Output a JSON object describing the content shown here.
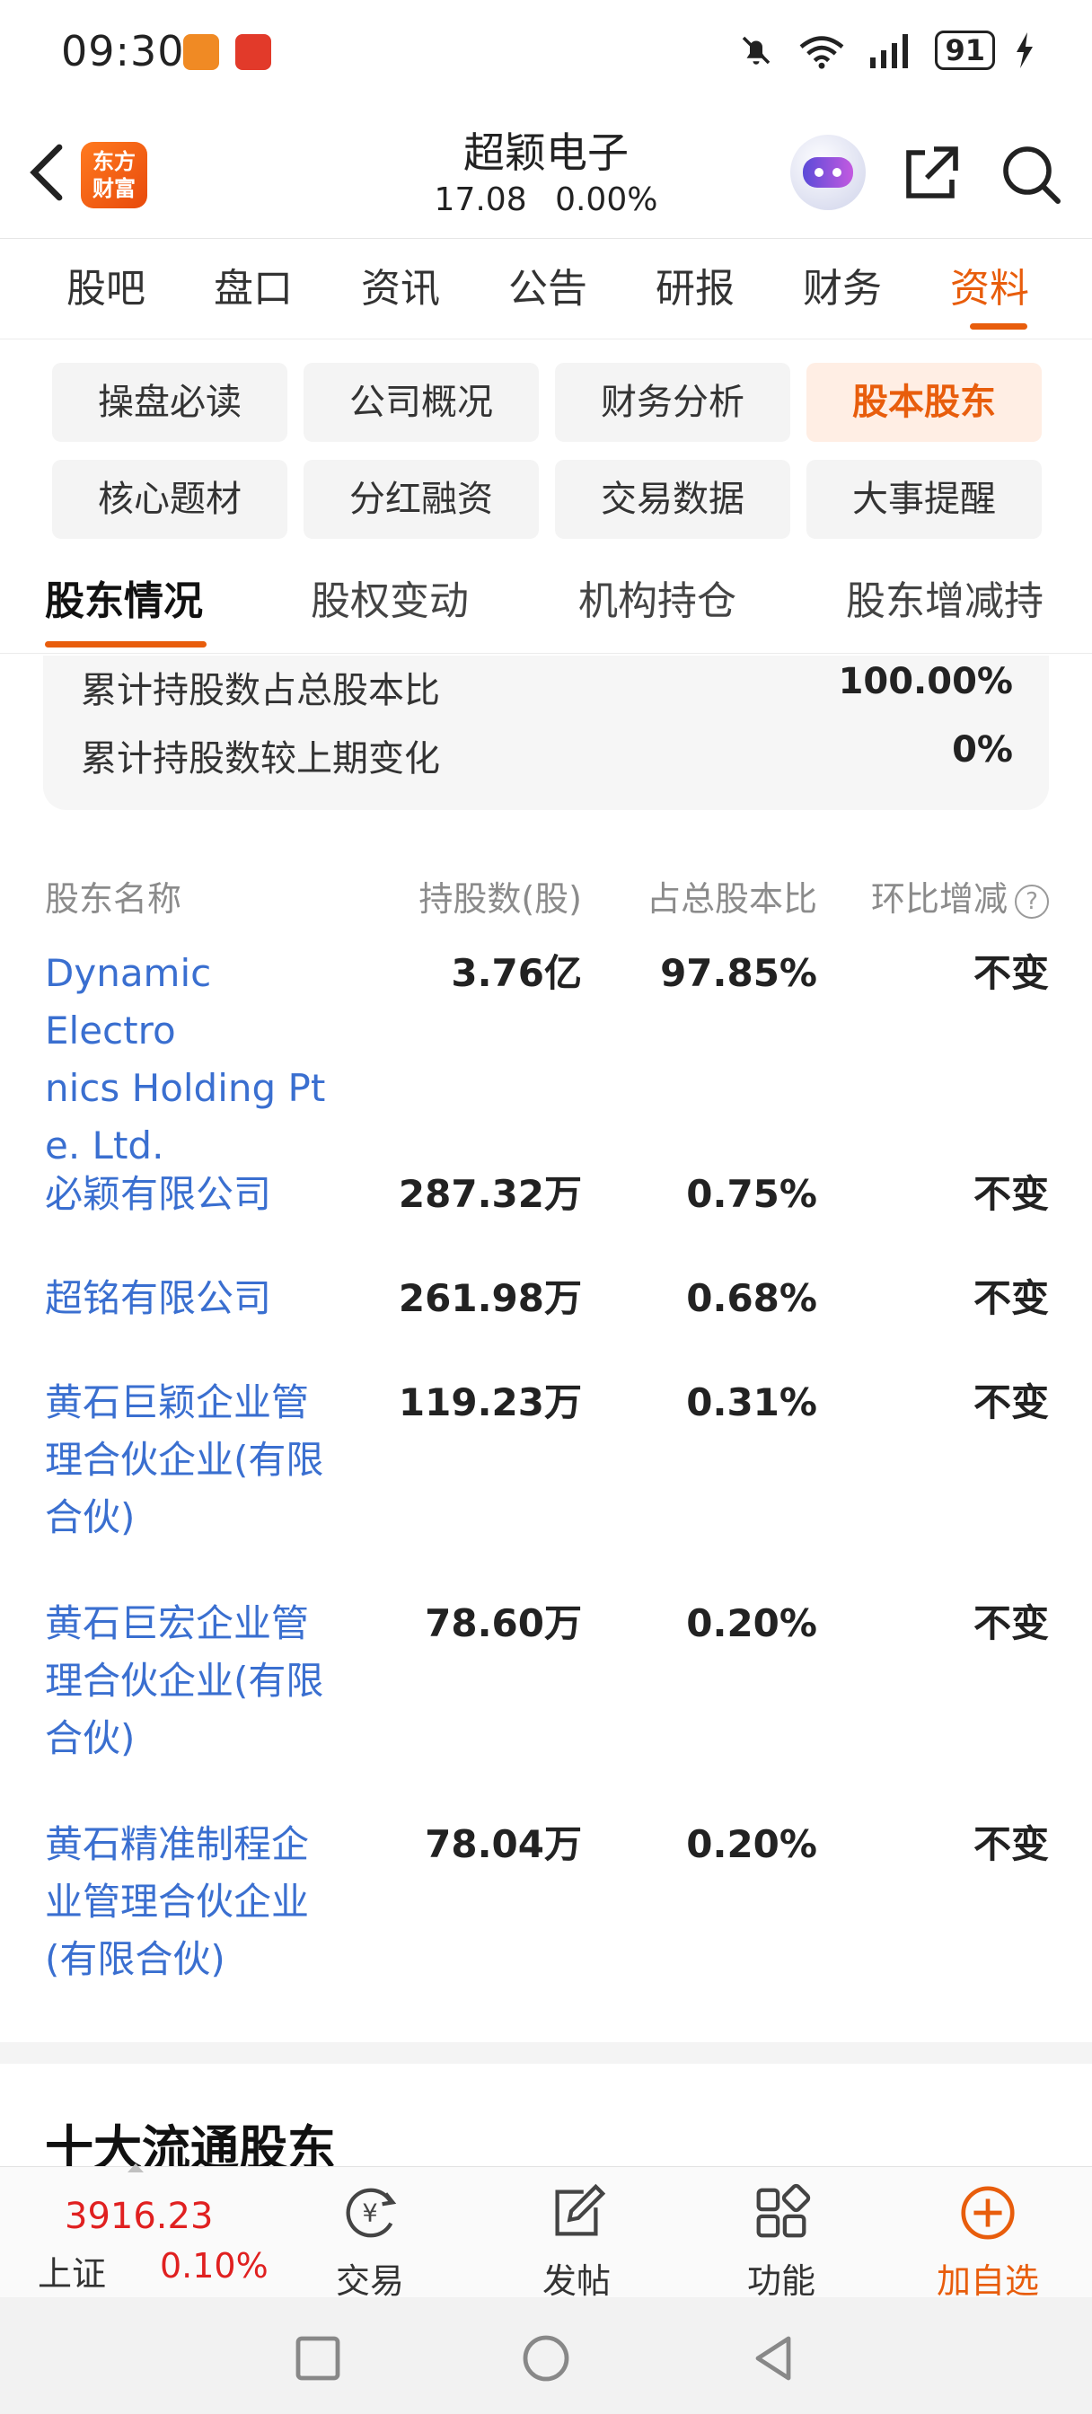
{
  "status_bar": {
    "time": "09:30",
    "battery": "91",
    "network": "6"
  },
  "header": {
    "logo_text_line1": "东方",
    "logo_text_line2": "财富",
    "stock_name": "超颖电子",
    "price": "17.08",
    "change_pct": "0.00%"
  },
  "main_tabs": [
    {
      "label": "股吧",
      "active": false
    },
    {
      "label": "盘口",
      "active": false
    },
    {
      "label": "资讯",
      "active": false
    },
    {
      "label": "公告",
      "active": false
    },
    {
      "label": "研报",
      "active": false
    },
    {
      "label": "财务",
      "active": false
    },
    {
      "label": "资料",
      "active": true
    }
  ],
  "sub_buttons": [
    {
      "label": "操盘必读",
      "active": false
    },
    {
      "label": "公司概况",
      "active": false
    },
    {
      "label": "财务分析",
      "active": false
    },
    {
      "label": "股本股东",
      "active": true
    },
    {
      "label": "核心题材",
      "active": false
    },
    {
      "label": "分红融资",
      "active": false
    },
    {
      "label": "交易数据",
      "active": false
    },
    {
      "label": "大事提醒",
      "active": false
    }
  ],
  "secondary_tabs": [
    {
      "label": "股东情况",
      "active": true
    },
    {
      "label": "股权变动",
      "active": false
    },
    {
      "label": "机构持仓",
      "active": false
    },
    {
      "label": "股东增减持",
      "active": false
    }
  ],
  "summary": [
    {
      "label": "累计持股数占总股本比",
      "value": "100.00%"
    },
    {
      "label": "累计持股数较上期变化",
      "value": "0%"
    }
  ],
  "holders_table": {
    "headers": {
      "name": "股东名称",
      "shares": "持股数(股)",
      "ratio": "占总股本比",
      "change": "环比增减"
    },
    "rows": [
      {
        "name_lines": [
          "Dynamic Electro",
          "nics Holding Pt",
          "e. Ltd."
        ],
        "shares": "3.76亿",
        "ratio": "97.85%",
        "change": "不变"
      },
      {
        "name_lines": [
          "必颖有限公司"
        ],
        "shares": "287.32万",
        "ratio": "0.75%",
        "change": "不变"
      },
      {
        "name_lines": [
          "超铭有限公司"
        ],
        "shares": "261.98万",
        "ratio": "0.68%",
        "change": "不变"
      },
      {
        "name_lines": [
          "黄石巨颖企业管",
          "理合伙企业(有限",
          "合伙)"
        ],
        "shares": "119.23万",
        "ratio": "0.31%",
        "change": "不变"
      },
      {
        "name_lines": [
          "黄石巨宏企业管",
          "理合伙企业(有限",
          "合伙)"
        ],
        "shares": "78.60万",
        "ratio": "0.20%",
        "change": "不变"
      },
      {
        "name_lines": [
          "黄石精准制程企",
          "业管理合伙企业",
          "(有限合伙)"
        ],
        "shares": "78.04万",
        "ratio": "0.20%",
        "change": "不变"
      }
    ]
  },
  "section_title": "十大流通股东",
  "bottom_nav": {
    "index_value": "3916.23",
    "index_name": "上证",
    "index_change": "0.10%",
    "items": [
      {
        "label": "交易",
        "icon": "trade-icon"
      },
      {
        "label": "发帖",
        "icon": "post-icon"
      },
      {
        "label": "功能",
        "icon": "apps-icon"
      },
      {
        "label": "加自选",
        "icon": "add-watchlist-icon"
      }
    ]
  },
  "colors": {
    "accent": "#e85d0c",
    "link": "#3a6fd0",
    "rise": "#e02020"
  }
}
